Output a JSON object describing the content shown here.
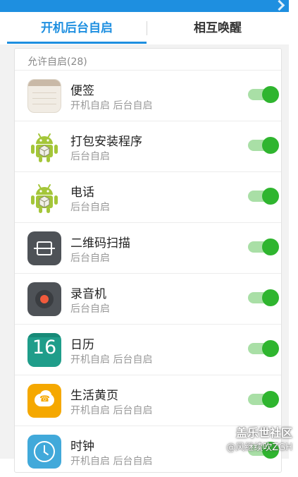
{
  "tabs": [
    {
      "label": "开机后台自启",
      "active": true
    },
    {
      "label": "相互唤醒",
      "active": false
    }
  ],
  "section": {
    "header": "允许自启(28)"
  },
  "apps": [
    {
      "name": "便签",
      "status": "开机自启 后台自启",
      "icon": "notes-icon",
      "enabled": true
    },
    {
      "name": "打包安装程序",
      "status": "后台自启",
      "icon": "android-icon",
      "enabled": true
    },
    {
      "name": "电话",
      "status": "后台自启",
      "icon": "android-icon",
      "enabled": true
    },
    {
      "name": "二维码扫描",
      "status": "后台自启",
      "icon": "qr-scanner-icon",
      "enabled": true
    },
    {
      "name": "录音机",
      "status": "后台自启",
      "icon": "recorder-icon",
      "enabled": true
    },
    {
      "name": "日历",
      "status": "开机自启 后台自启",
      "icon": "calendar-icon",
      "calendar_day": "16",
      "enabled": true
    },
    {
      "name": "生活黄页",
      "status": "开机自启 后台自启",
      "icon": "yellow-pages-icon",
      "enabled": true
    },
    {
      "name": "时钟",
      "status": "开机自启 后台自启",
      "icon": "clock-icon",
      "enabled": true
    }
  ],
  "watermark": {
    "title": "盖乐世社区",
    "handle": "@风继续吹ZGH"
  },
  "colors": {
    "accent": "#1e8fe0",
    "toggle_on": "#2fb52f",
    "android_green": "#a4c639"
  }
}
